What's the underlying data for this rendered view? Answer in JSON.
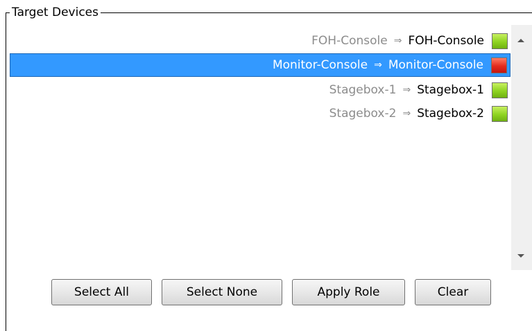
{
  "group": {
    "title": "Target Devices"
  },
  "devices": [
    {
      "source": "FOH-Console",
      "arrow": "⇒",
      "target": "FOH-Console",
      "status": "green",
      "selected": false
    },
    {
      "source": "Monitor-Console",
      "arrow": "⇒",
      "target": "Monitor-Console",
      "status": "red",
      "selected": true
    },
    {
      "source": "Stagebox-1",
      "arrow": "⇒",
      "target": "Stagebox-1",
      "status": "green",
      "selected": false
    },
    {
      "source": "Stagebox-2",
      "arrow": "⇒",
      "target": "Stagebox-2",
      "status": "green",
      "selected": false
    }
  ],
  "colors": {
    "selection": "#3399ff",
    "status_ok": "#8ed321",
    "status_error": "#e32b1d",
    "source_text": "#8c8c8c"
  },
  "buttons": {
    "select_all": "Select All",
    "select_none": "Select None",
    "apply_role": "Apply Role",
    "clear": "Clear"
  }
}
